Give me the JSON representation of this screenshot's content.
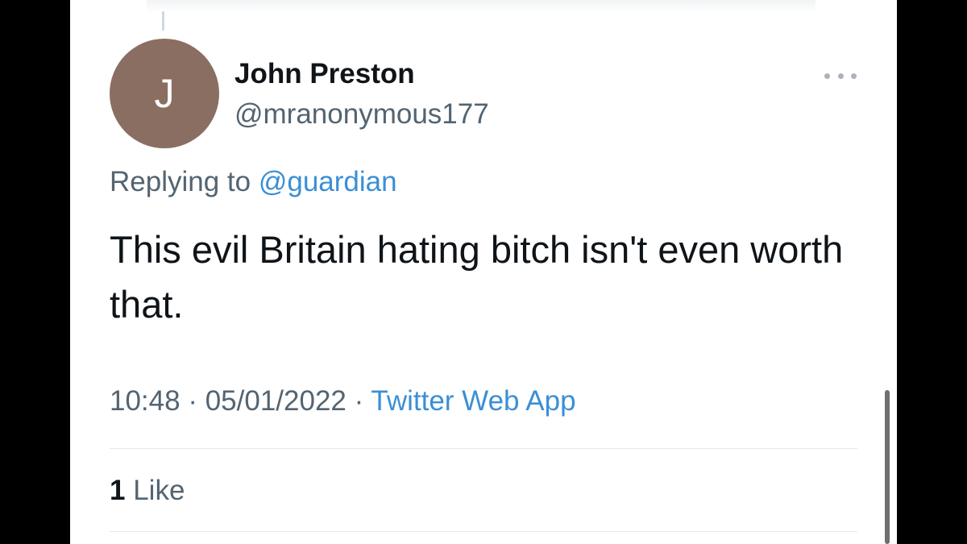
{
  "tweet": {
    "avatar_letter": "J",
    "avatar_color": "#8b6e62",
    "display_name": "John Preston",
    "handle": "@mranonymous177",
    "replying_prefix": "Replying to",
    "replying_handle": "@guardian",
    "text": "This evil Britain hating bitch isn't even worth that.",
    "time": "10:48",
    "date": "05/01/2022",
    "separator": "·",
    "source": "Twitter Web App",
    "like_count": "1",
    "like_label": "Like",
    "more_icon": "more-horizontal-icon"
  },
  "colors": {
    "link": "#3b8fd6",
    "text_primary": "#0f1419",
    "text_secondary": "#536471"
  }
}
